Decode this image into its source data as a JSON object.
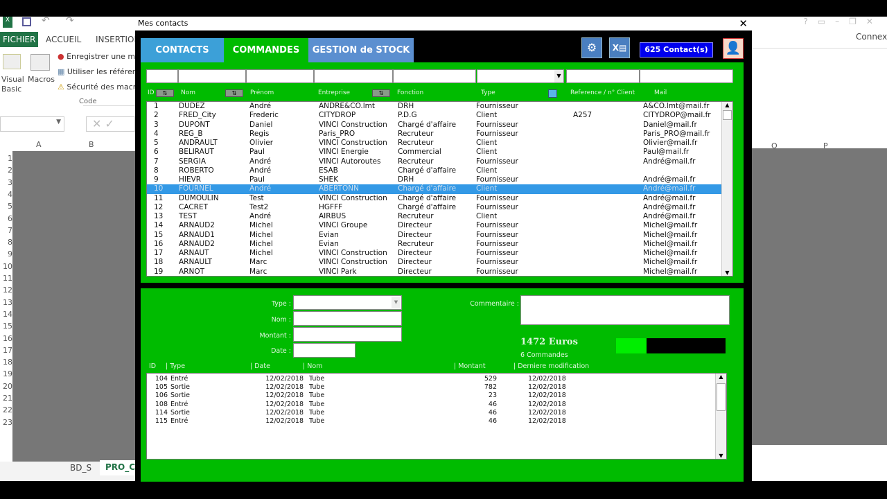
{
  "excel": {
    "ribbon_tabs": [
      "FICHIER",
      "ACCUEIL",
      "INSERTION"
    ],
    "ribbon_items": [
      "Enregistrer une ma",
      "Utiliser les référenc",
      "Sécurité des macro"
    ],
    "visual_basic": "Visual Basic",
    "macros": "Macros",
    "group": "Code",
    "columns_left": [
      "A",
      "B"
    ],
    "columns_right": [
      "O",
      "P"
    ],
    "row_numbers": [
      "1",
      "2",
      "3",
      "4",
      "5",
      "6",
      "7",
      "8",
      "9",
      "10",
      "11",
      "12",
      "13",
      "14",
      "15",
      "16",
      "17",
      "18",
      "19",
      "20",
      "21",
      "22",
      "23"
    ],
    "sheet_tabs": [
      "BD_S",
      "PRO_CO"
    ],
    "connexion": "Connexio"
  },
  "dialog": {
    "title": "Mes contacts",
    "tabs": [
      "CONTACTS",
      "COMMANDES",
      "GESTION de STOCK"
    ],
    "contact_count": "625 Contact(s)",
    "colors": {
      "green": "#00bb00",
      "selected": "#3399e6",
      "counter": "#0000ee"
    }
  },
  "contacts": {
    "headers": [
      "ID",
      "Nom",
      "Prénom",
      "Entreprise",
      "Fonction",
      "Type",
      "Reference / n° Client",
      "Mail"
    ],
    "rows": [
      [
        "1",
        "DUDEZ",
        "André",
        "ANDRE&CO.lmt",
        "DRH",
        "Fournisseur",
        "",
        "A&CO.lmt@mail.fr"
      ],
      [
        "2",
        "FRED_City",
        "Frederic",
        "CITYDROP",
        "P.D.G",
        "Client",
        "A257",
        "CITYDROP@mail.fr"
      ],
      [
        "3",
        "DUPONT",
        "Daniel",
        "VINCI Construction",
        "Chargé d'affaire",
        "Fournisseur",
        "",
        "Daniel@mail.fr"
      ],
      [
        "4",
        "REG_B",
        "Regis",
        "Paris_PRO",
        "Recruteur",
        "Fournisseur",
        "",
        "Paris_PRO@mail.fr"
      ],
      [
        "5",
        "ANDRAULT",
        "Olivier",
        "VINCI Construction",
        "Recruteur",
        "Client",
        "",
        "Olivier@mail.fr"
      ],
      [
        "6",
        "BELIRAUT",
        "Paul",
        "VINCI Energie",
        "Commercial",
        "Client",
        "",
        "Paul@mail.fr"
      ],
      [
        "7",
        "SERGIA",
        "André",
        "VINCI Autoroutes",
        "Recruteur",
        "Fournisseur",
        "",
        "André@mail.fr"
      ],
      [
        "8",
        "ROBERTO",
        "André",
        "ESAB",
        "Chargé d'affaire",
        "Client",
        "",
        ""
      ],
      [
        "9",
        "HIEVR",
        "Paul",
        "SHEK",
        "DRH",
        "Fournisseur",
        "",
        "André@mail.fr"
      ],
      [
        "10",
        "FOURNEL",
        "André",
        "ABERTONN",
        "Chargé d'affaire",
        "Client",
        "",
        "André@mail.fr"
      ],
      [
        "11",
        "DUMOULIN",
        "Test",
        "VINCI Construction",
        "Chargé d'affaire",
        "Fournisseur",
        "",
        "André@mail.fr"
      ],
      [
        "12",
        "CACRET",
        "Test2",
        "HGFFF",
        "Chargé d'affaire",
        "Fournisseur",
        "",
        "André@mail.fr"
      ],
      [
        "13",
        "TEST",
        "André",
        "AIRBUS",
        "Recruteur",
        "Client",
        "",
        "André@mail.fr"
      ],
      [
        "14",
        "ARNAUD2",
        "Michel",
        "VINCI Groupe",
        "Directeur",
        "Fournisseur",
        "",
        "Michel@mail.fr"
      ],
      [
        "15",
        "ARNAUD1",
        "Michel",
        "Evian",
        "Directeur",
        "Fournisseur",
        "",
        "Michel@mail.fr"
      ],
      [
        "16",
        "ARNAUD2",
        "Michel",
        "Evian",
        "Recruteur",
        "Fournisseur",
        "",
        "Michel@mail.fr"
      ],
      [
        "17",
        "ARNAUT",
        "Michel",
        "VINCI Construction",
        "Directeur",
        "Fournisseur",
        "",
        "Michel@mail.fr"
      ],
      [
        "18",
        "ARNAULT",
        "Marc",
        "VINCI Construction",
        "Directeur",
        "Fournisseur",
        "",
        "Michel@mail.fr"
      ],
      [
        "19",
        "ARNOT",
        "Marc",
        "VINCI Park",
        "Directeur",
        "Fournisseur",
        "",
        "Michel@mail.fr"
      ]
    ],
    "selected_index": 9
  },
  "order_form": {
    "type_label": "Type :",
    "nom_label": "Nom :",
    "montant_label": "Montant :",
    "date_label": "Date :",
    "commentaire_label": "Commentaire :",
    "type_value": "",
    "nom_value": "",
    "montant_value": "",
    "date_value": "",
    "commentaire_value": "",
    "total": "1472 Euros",
    "count": "6 Commandes",
    "progress_fraction": 0.28
  },
  "orders": {
    "headers": [
      "ID",
      "Type",
      "Date",
      "Nom",
      "Montant",
      "Derniere modification"
    ],
    "rows": [
      [
        "104",
        "Entré",
        "12/02/2018",
        "Tube",
        "529",
        "12/02/2018"
      ],
      [
        "105",
        "Sortie",
        "12/02/2018",
        "Tube",
        "782",
        "12/02/2018"
      ],
      [
        "106",
        "Sortie",
        "12/02/2018",
        "Tube",
        "23",
        "12/02/2018"
      ],
      [
        "108",
        "Entré",
        "12/02/2018",
        "Tube",
        "46",
        "12/02/2018"
      ],
      [
        "114",
        "Sortie",
        "12/02/2018",
        "Tube",
        "46",
        "12/02/2018"
      ],
      [
        "115",
        "Entré",
        "12/02/2018",
        "Tube",
        "46",
        "12/02/2018"
      ]
    ]
  }
}
